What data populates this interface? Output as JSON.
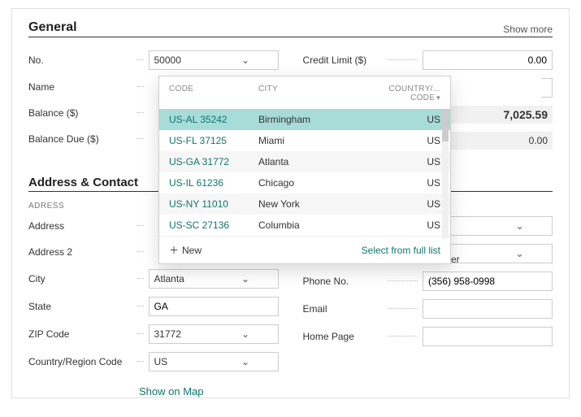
{
  "general": {
    "title": "General",
    "show_more": "Show more",
    "no_label": "No.",
    "no_value": "50000",
    "name_label": "Name",
    "balance_label": "Balance ($)",
    "balance_due_label": "Balance Due ($)",
    "credit_limit_label": "Credit Limit ($)",
    "credit_limit_value": "0.00",
    "balance_value": "7,025.59",
    "balance_due_value": "0.00"
  },
  "dropdown": {
    "head_code": "CODE",
    "head_city": "CITY",
    "head_cc1": "COUNTRY/...",
    "head_cc2": "CODE",
    "new_label": "New",
    "select_full": "Select from full list",
    "rows": [
      {
        "code": "US-AL 35242",
        "city": "Birmingham",
        "cc": "US"
      },
      {
        "code": "US-FL 37125",
        "city": "Miami",
        "cc": "US"
      },
      {
        "code": "US-GA 31772",
        "city": "Atlanta",
        "cc": "US"
      },
      {
        "code": "US-IL 61236",
        "city": "Chicago",
        "cc": "US"
      },
      {
        "code": "US-NY 11010",
        "city": "New York",
        "cc": "US"
      },
      {
        "code": "US-SC 27136",
        "city": "Columbia",
        "cc": "US"
      }
    ]
  },
  "addr": {
    "title": "Address & Contact",
    "sub": "ADRESS",
    "address_label": "Address",
    "address2_label": "Address 2",
    "city_label": "City",
    "city_value": "Atlanta",
    "state_label": "State",
    "state_value": "GA",
    "zip_label": "ZIP Code",
    "zip_value": "31772",
    "crc_label": "Country/Region Code",
    "crc_value": "US",
    "map_link": "Show on Map"
  },
  "contact": {
    "contact_value": "esse Holmer",
    "phone_label": "Phone No.",
    "phone_value": "(356) 958-0998",
    "email_label": "Email",
    "home_label": "Home Page"
  }
}
